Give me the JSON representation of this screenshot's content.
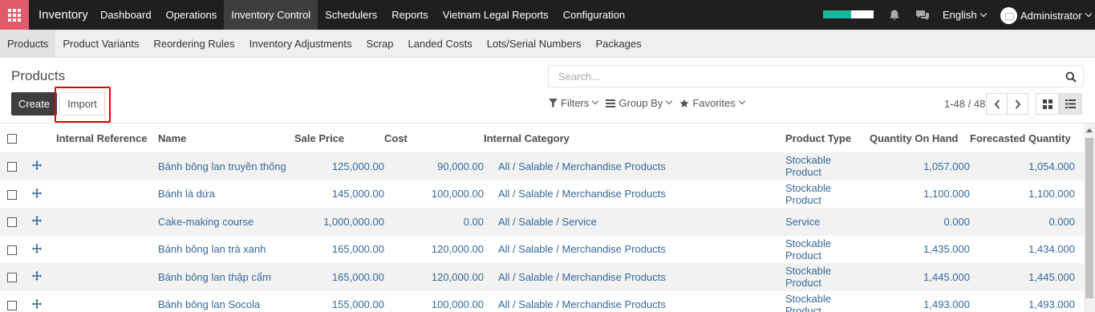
{
  "topbar": {
    "app_title": "Inventory",
    "menu": [
      {
        "label": "Dashboard",
        "active": false
      },
      {
        "label": "Operations",
        "active": false
      },
      {
        "label": "Inventory Control",
        "active": true
      },
      {
        "label": "Schedulers",
        "active": false
      },
      {
        "label": "Reports",
        "active": false
      },
      {
        "label": "Vietnam Legal Reports",
        "active": false
      },
      {
        "label": "Configuration",
        "active": false
      }
    ],
    "progress_fraction": 0.55,
    "accent_color": "#19b69b",
    "apps_color": "#e25b6a",
    "language": "English",
    "user": "Administrator"
  },
  "submenu": [
    {
      "label": "Products",
      "active": true
    },
    {
      "label": "Product Variants",
      "active": false
    },
    {
      "label": "Reordering Rules",
      "active": false
    },
    {
      "label": "Inventory Adjustments",
      "active": false
    },
    {
      "label": "Scrap",
      "active": false
    },
    {
      "label": "Landed Costs",
      "active": false
    },
    {
      "label": "Lots/Serial Numbers",
      "active": false
    },
    {
      "label": "Packages",
      "active": false
    }
  ],
  "control_panel": {
    "breadcrumb": "Products",
    "create_label": "Create",
    "import_label": "Import",
    "search_placeholder": "Search...",
    "filters_label": "Filters",
    "group_by_label": "Group By",
    "favorites_label": "Favorites",
    "pager": "1-48 / 48"
  },
  "table": {
    "columns": [
      "Internal Reference",
      "Name",
      "Sale Price",
      "Cost",
      "Internal Category",
      "Product Type",
      "Quantity On Hand",
      "Forecasted Quantity"
    ],
    "rows": [
      {
        "ref": "",
        "name": "Bánh bông lan truyền thống",
        "sale_price": "125,000.00",
        "cost": "90,000.00",
        "category": "All / Salable / Merchandise Products",
        "type": "Stockable Product",
        "on_hand": "1,057.000",
        "forecast": "1,054.000"
      },
      {
        "ref": "",
        "name": "Bánh lá dứa",
        "sale_price": "145,000.00",
        "cost": "100,000.00",
        "category": "All / Salable / Merchandise Products",
        "type": "Stockable Product",
        "on_hand": "1,100.000",
        "forecast": "1,100.000"
      },
      {
        "ref": "",
        "name": "Cake-making course",
        "sale_price": "1,000,000.00",
        "cost": "0.00",
        "category": "All / Salable / Service",
        "type": "Service",
        "on_hand": "0.000",
        "forecast": "0.000"
      },
      {
        "ref": "",
        "name": "Bánh bông lan trà xanh",
        "sale_price": "165,000.00",
        "cost": "120,000.00",
        "category": "All / Salable / Merchandise Products",
        "type": "Stockable Product",
        "on_hand": "1,435.000",
        "forecast": "1,434.000"
      },
      {
        "ref": "",
        "name": "Bánh bông lan thập cẩm",
        "sale_price": "165,000.00",
        "cost": "120,000.00",
        "category": "All / Salable / Merchandise Products",
        "type": "Stockable Product",
        "on_hand": "1,445.000",
        "forecast": "1,445.000"
      },
      {
        "ref": "",
        "name": "Bánh bông lan Socola",
        "sale_price": "155,000.00",
        "cost": "100,000.00",
        "category": "All / Salable / Merchandise Products",
        "type": "Stockable Product",
        "on_hand": "1,493.000",
        "forecast": "1,493.000"
      }
    ]
  }
}
